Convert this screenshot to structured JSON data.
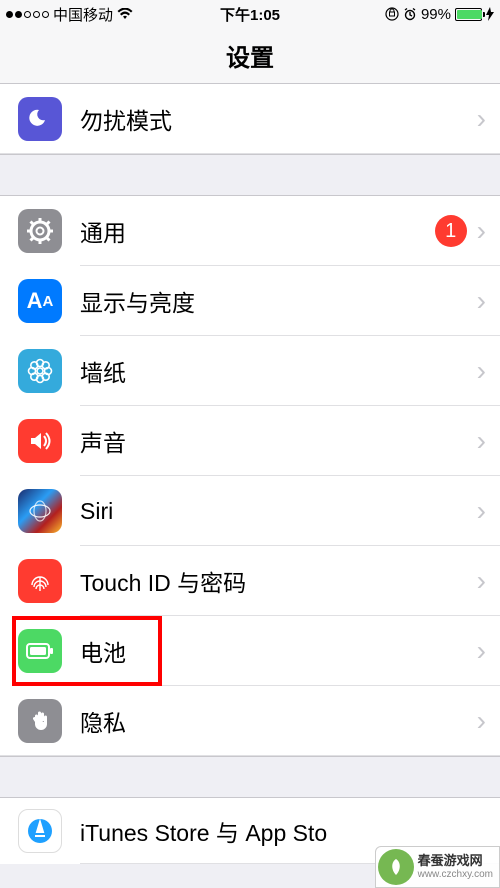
{
  "status_bar": {
    "carrier": "中国移动",
    "time": "下午1:05",
    "battery_pct": "99%"
  },
  "nav": {
    "title": "设置"
  },
  "sections": {
    "s0": {
      "dnd": "勿扰模式"
    },
    "s1": {
      "general": "通用",
      "general_badge": "1",
      "display": "显示与亮度",
      "wallpaper": "墙纸",
      "sounds": "声音",
      "siri": "Siri",
      "touchid": "Touch ID 与密码",
      "battery": "电池",
      "privacy": "隐私"
    },
    "s2": {
      "itunes": "iTunes Store 与 App Sto"
    }
  },
  "watermark": {
    "line1": "春蚕游戏网",
    "line2": "www.czchxy.com"
  }
}
